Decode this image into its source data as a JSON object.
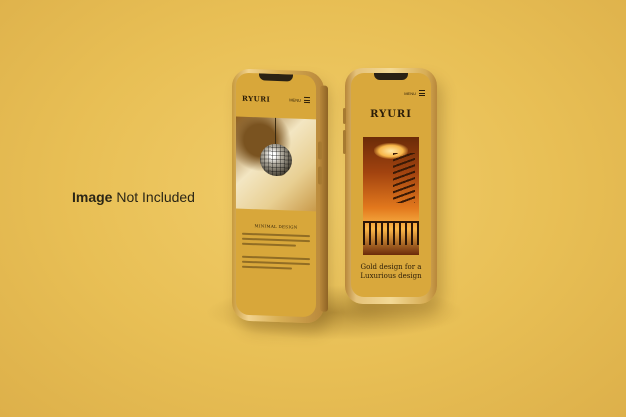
{
  "caption": {
    "bold": "Image",
    "rest": "Not Included"
  },
  "phone_left": {
    "logo": "RYURI",
    "menu_label": "MENU",
    "section_title": "MINIMAL DESIGN",
    "icons": [
      "hamburger-icon",
      "disco-ball-image"
    ]
  },
  "phone_right": {
    "menu_label": "MENU",
    "logo": "RYURI",
    "headline_line1": "Gold design for a",
    "headline_line2": "Luxurious design",
    "icons": [
      "hamburger-icon",
      "staircase-image"
    ]
  },
  "colors": {
    "background": "#ebc459",
    "phone_gold": "#d9b056",
    "screen": "#d8a73a",
    "ink": "#2b1d08"
  }
}
